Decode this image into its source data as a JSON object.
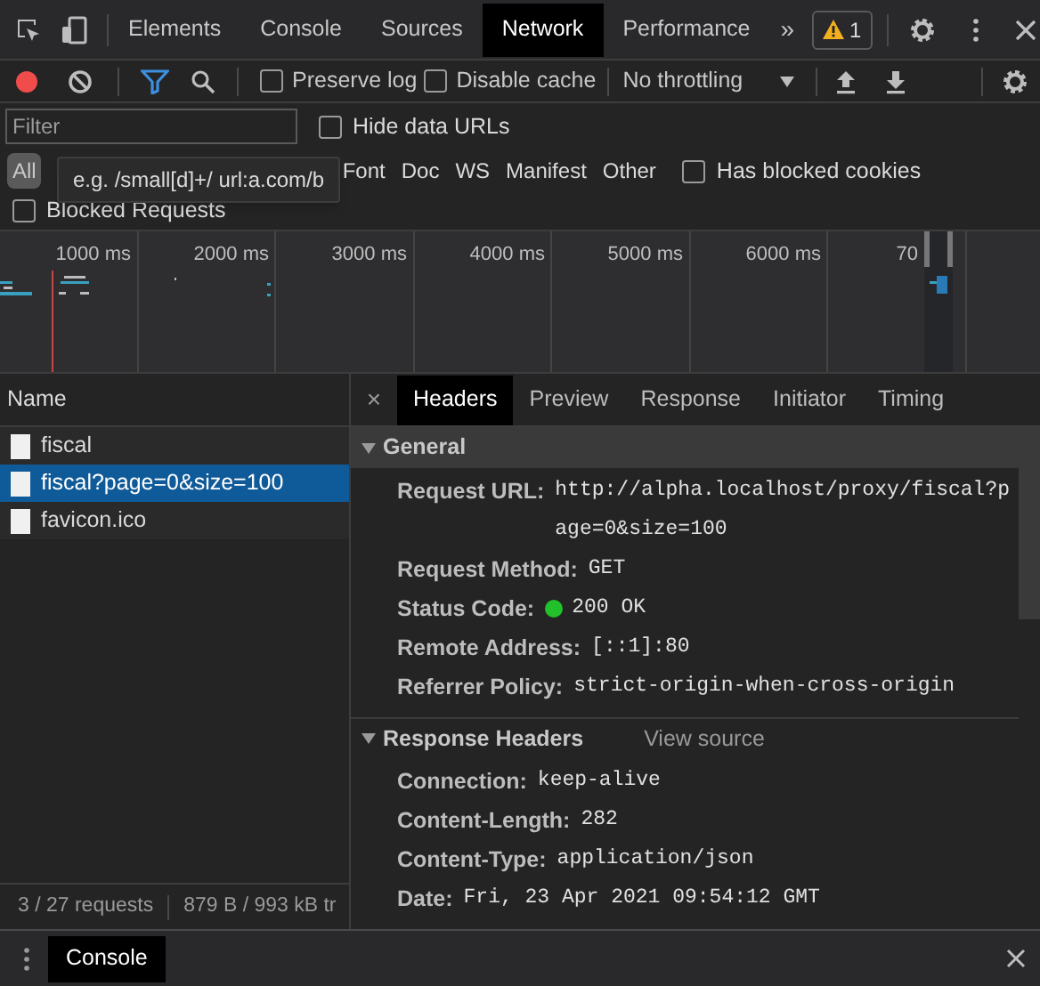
{
  "main_tabs": [
    {
      "label": "Elements",
      "selected": false
    },
    {
      "label": "Console",
      "selected": false
    },
    {
      "label": "Sources",
      "selected": false
    },
    {
      "label": "Network",
      "selected": true
    },
    {
      "label": "Performance",
      "selected": false
    }
  ],
  "more_tabs": "»",
  "warning_count": "1",
  "toolbar": {
    "recording": true,
    "filter_active": true,
    "checkboxes": [
      {
        "label": "Preserve log",
        "checked": false
      },
      {
        "label": "Disable cache",
        "checked": false
      }
    ],
    "throttling": "No throttling"
  },
  "filter": {
    "placeholder": "Filter",
    "hide_data_urls": {
      "label": "Hide data URLs",
      "checked": false
    }
  },
  "type_filters": [
    {
      "label": "All",
      "selected": true
    },
    {
      "label": "Font",
      "selected": false
    },
    {
      "label": "Doc",
      "selected": false
    },
    {
      "label": "WS",
      "selected": false
    },
    {
      "label": "Manifest",
      "selected": false
    },
    {
      "label": "Other",
      "selected": false
    }
  ],
  "has_blocked_cookies": {
    "label": "Has blocked cookies",
    "checked": false
  },
  "blocked_requests": {
    "label": "Blocked Requests",
    "checked": false
  },
  "tooltip": "e.g. /small[d]+/ url:a.com/b",
  "overview": {
    "ticks": [
      "1000 ms",
      "2000 ms",
      "3000 ms",
      "4000 ms",
      "5000 ms",
      "6000 ms",
      "70"
    ]
  },
  "requests": {
    "column": "Name",
    "rows": [
      {
        "name": "fiscal",
        "selected": false
      },
      {
        "name": "fiscal?page=0&size=100",
        "selected": true
      },
      {
        "name": "favicon.ico",
        "selected": false
      }
    ],
    "summary": [
      "3 / 27 requests",
      "879 B / 993 kB tr"
    ]
  },
  "detail_close": "×",
  "detail_tabs": [
    {
      "label": "Headers",
      "selected": true
    },
    {
      "label": "Preview",
      "selected": false
    },
    {
      "label": "Response",
      "selected": false
    },
    {
      "label": "Initiator",
      "selected": false
    },
    {
      "label": "Timing",
      "selected": false
    }
  ],
  "sections": [
    {
      "title": "General",
      "expanded": true,
      "headers": [
        {
          "name": "Request URL:",
          "value": "http://alpha.localhost/proxy/fiscal?page=0&size=100"
        },
        {
          "name": "Request Method:",
          "value": "GET"
        },
        {
          "name": "Status Code:",
          "value": "200 OK",
          "color": "#22c02a"
        },
        {
          "name": "Remote Address:",
          "value": "[::1]:80"
        },
        {
          "name": "Referrer Policy:",
          "value": "strict-origin-when-cross-origin"
        }
      ]
    },
    {
      "title": "Response Headers",
      "link": "View source",
      "expanded": true,
      "headers": [
        {
          "name": "Connection:",
          "value": "keep-alive"
        },
        {
          "name": "Content-Length:",
          "value": "282"
        },
        {
          "name": "Content-Type:",
          "value": "application/json"
        },
        {
          "name": "Date:",
          "value": "Fri, 23 Apr 2021 09:54:12 GMT"
        }
      ]
    }
  ],
  "drawer": {
    "tabs": [
      {
        "label": "Console",
        "selected": true
      }
    ]
  }
}
